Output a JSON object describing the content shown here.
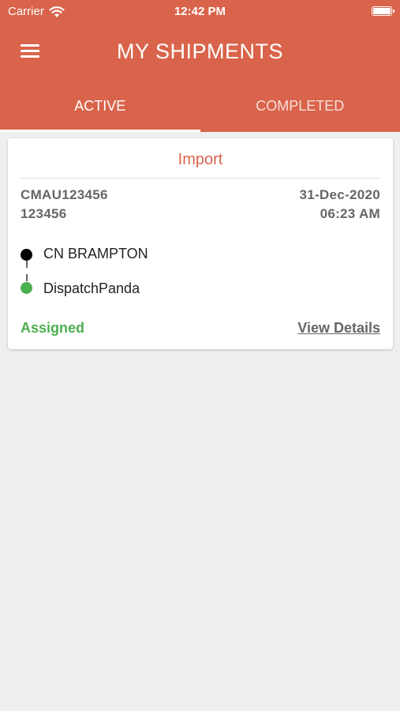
{
  "status_bar": {
    "carrier": "Carrier",
    "time": "12:42 PM",
    "wifi_icon": "wifi-icon",
    "battery_icon": "battery-icon"
  },
  "header": {
    "title": "MY SHIPMENTS",
    "menu_icon": "menu-icon",
    "background_color": "#d9644b"
  },
  "tabs": [
    {
      "label": "ACTIVE",
      "selected": true
    },
    {
      "label": "COMPLETED",
      "selected": false
    }
  ],
  "shipments": [
    {
      "type": "Import",
      "container": "CMAU123456",
      "number": "123456",
      "date": "31-Dec-2020",
      "time": "06:23 AM",
      "route": [
        {
          "name": "CN BRAMPTON",
          "dot_color": "#000000"
        },
        {
          "name": "DispatchPanda",
          "dot_color": "#4caf50"
        }
      ],
      "status": "Assigned",
      "status_color": "#4caf50",
      "action_label": "View Details"
    }
  ]
}
